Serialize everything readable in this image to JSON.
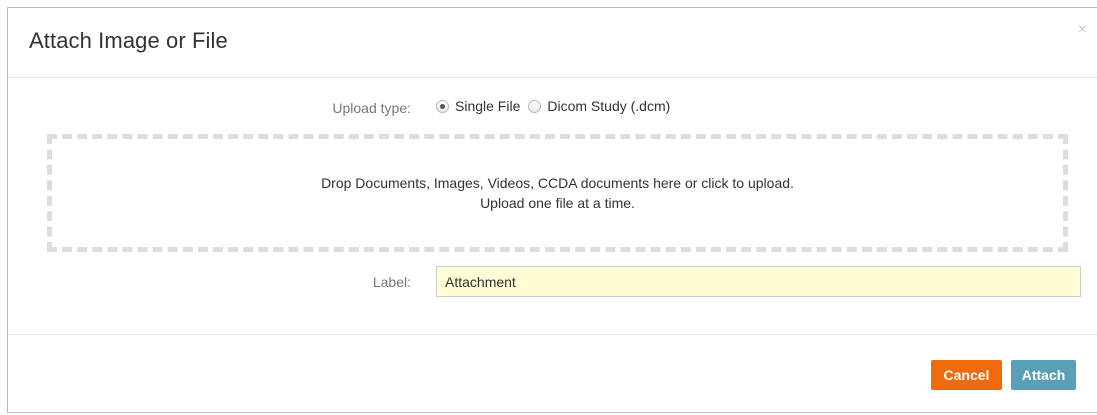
{
  "dialog": {
    "title": "Attach Image or File",
    "close_glyph": "×"
  },
  "upload_type": {
    "label": "Upload type:",
    "options": [
      {
        "label": "Single File",
        "selected": true
      },
      {
        "label": "Dicom Study (.dcm)",
        "selected": false
      }
    ]
  },
  "dropzone": {
    "line1": "Drop Documents, Images, Videos, CCDA documents here or click to upload.",
    "line2": "Upload one file at a time."
  },
  "label_field": {
    "label": "Label:",
    "value": "Attachment"
  },
  "footer": {
    "cancel_label": "Cancel",
    "attach_label": "Attach"
  },
  "colors": {
    "cancel": "#ee6a0c",
    "attach": "#5a9fb5",
    "input_bg": "#fffcd6"
  }
}
